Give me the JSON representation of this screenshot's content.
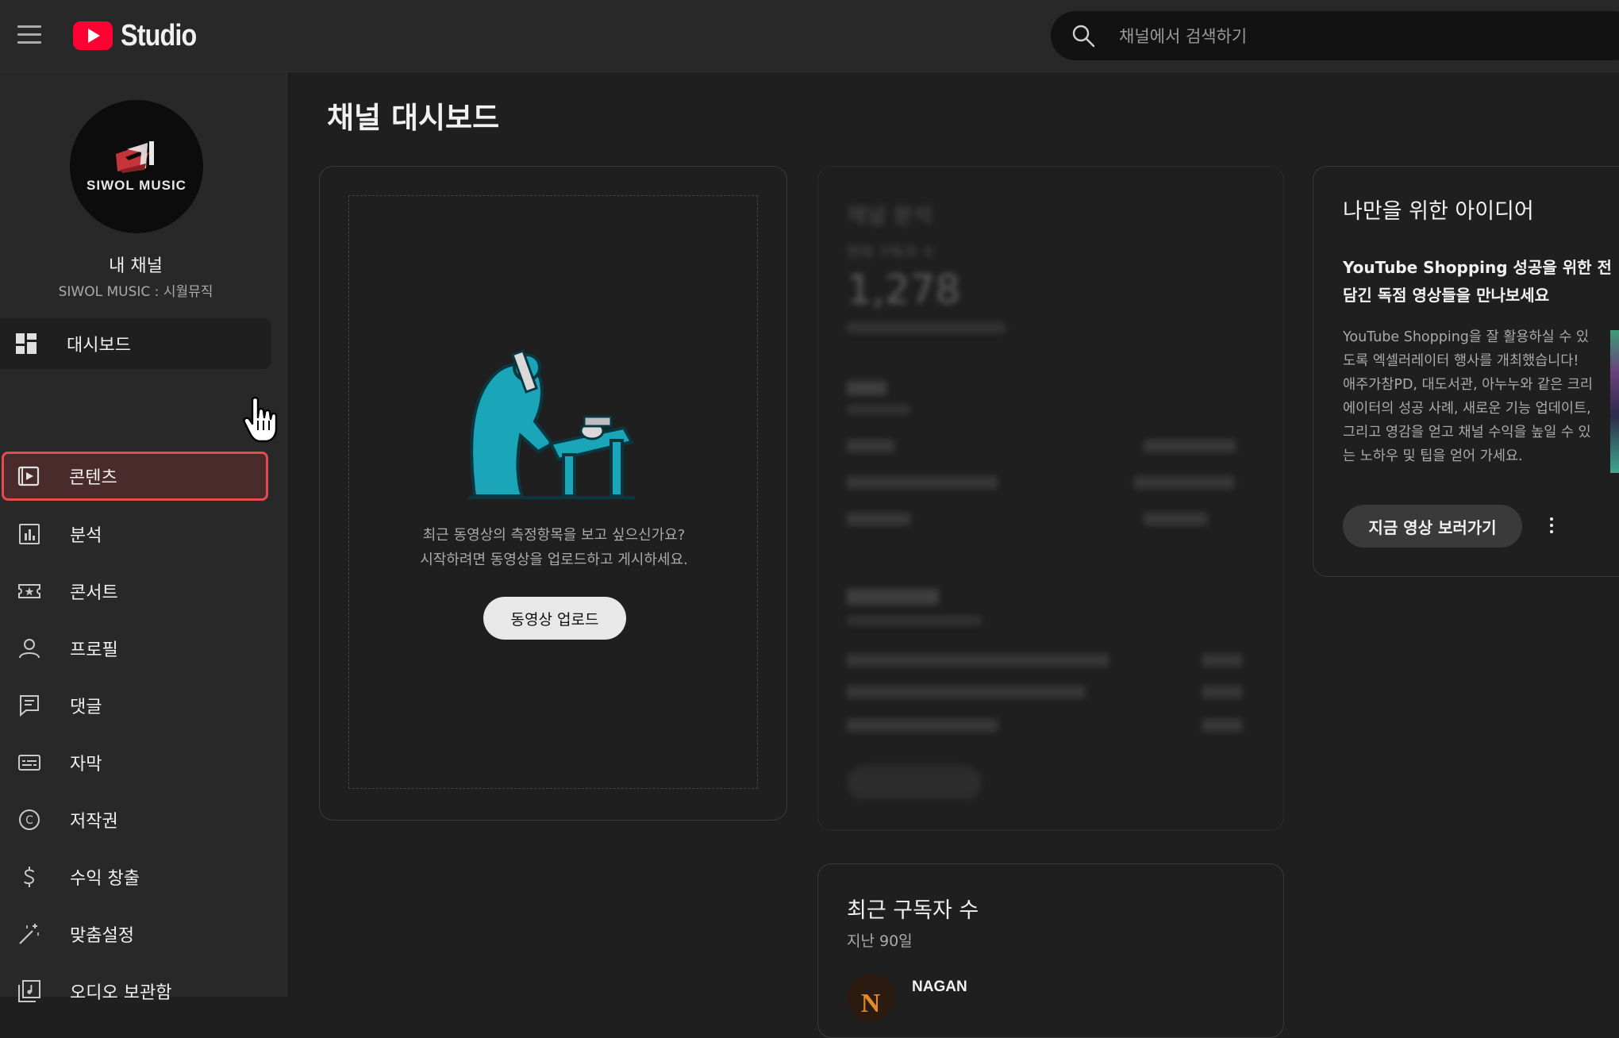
{
  "header": {
    "app_name": "Studio",
    "search_placeholder": "채널에서 검색하기"
  },
  "sidebar": {
    "avatar_text": "SIWOL MUSIC",
    "channel_title": "내 채널",
    "channel_name": "SIWOL MUSIC : 시월뮤직",
    "items": [
      {
        "label": "대시보드",
        "icon": "dashboard-icon"
      },
      {
        "label": "콘텐츠",
        "icon": "content-icon"
      },
      {
        "label": "분석",
        "icon": "analytics-icon"
      },
      {
        "label": "콘서트",
        "icon": "concert-icon"
      },
      {
        "label": "프로필",
        "icon": "profile-icon"
      },
      {
        "label": "댓글",
        "icon": "comments-icon"
      },
      {
        "label": "자막",
        "icon": "subtitles-icon"
      },
      {
        "label": "저작권",
        "icon": "copyright-icon"
      },
      {
        "label": "수익 창출",
        "icon": "monetization-icon"
      },
      {
        "label": "맞춤설정",
        "icon": "customization-icon"
      },
      {
        "label": "오디오 보관함",
        "icon": "audio-library-icon"
      }
    ]
  },
  "main": {
    "page_title": "채널 대시보드",
    "upload_card": {
      "line1": "최근 동영상의 측정항목을 보고 싶으신가요?",
      "line2": "시작하려면 동영상을 업로드하고 게시하세요.",
      "button": "동영상 업로드"
    },
    "analytics_card": {
      "title": "채널 분석",
      "subscribers_label": "현재 구독자 수",
      "subscribers_value": "1,278"
    },
    "ideas_card": {
      "title": "나만을 위한 아이디어",
      "subtitle_line1": "YouTube Shopping 성공을 위한 전",
      "subtitle_line2": "담긴 독점 영상들을 만나보세요",
      "body": "YouTube Shopping을 잘 활용하실 수 있도록 엑셀러레이터 행사를 개최했습니다! 애주가참PD, 대도서관, 아누누와 같은 크리에이터의 성공 사례, 새로운 기능 업데이트, 그리고 영감을 얻고 채널 수익을 높일 수 있는 노하우 및 팁을 얻어 가세요.",
      "button": "지금 영상 보러가기"
    },
    "subs_card": {
      "title": "최근 구독자 수",
      "period": "지난 90일",
      "first_name": "NAGAN"
    }
  },
  "colors": {
    "highlight_border": "#e34c4c",
    "youtube_red": "#ff0033",
    "accent_teal": "#1ba5b8"
  }
}
